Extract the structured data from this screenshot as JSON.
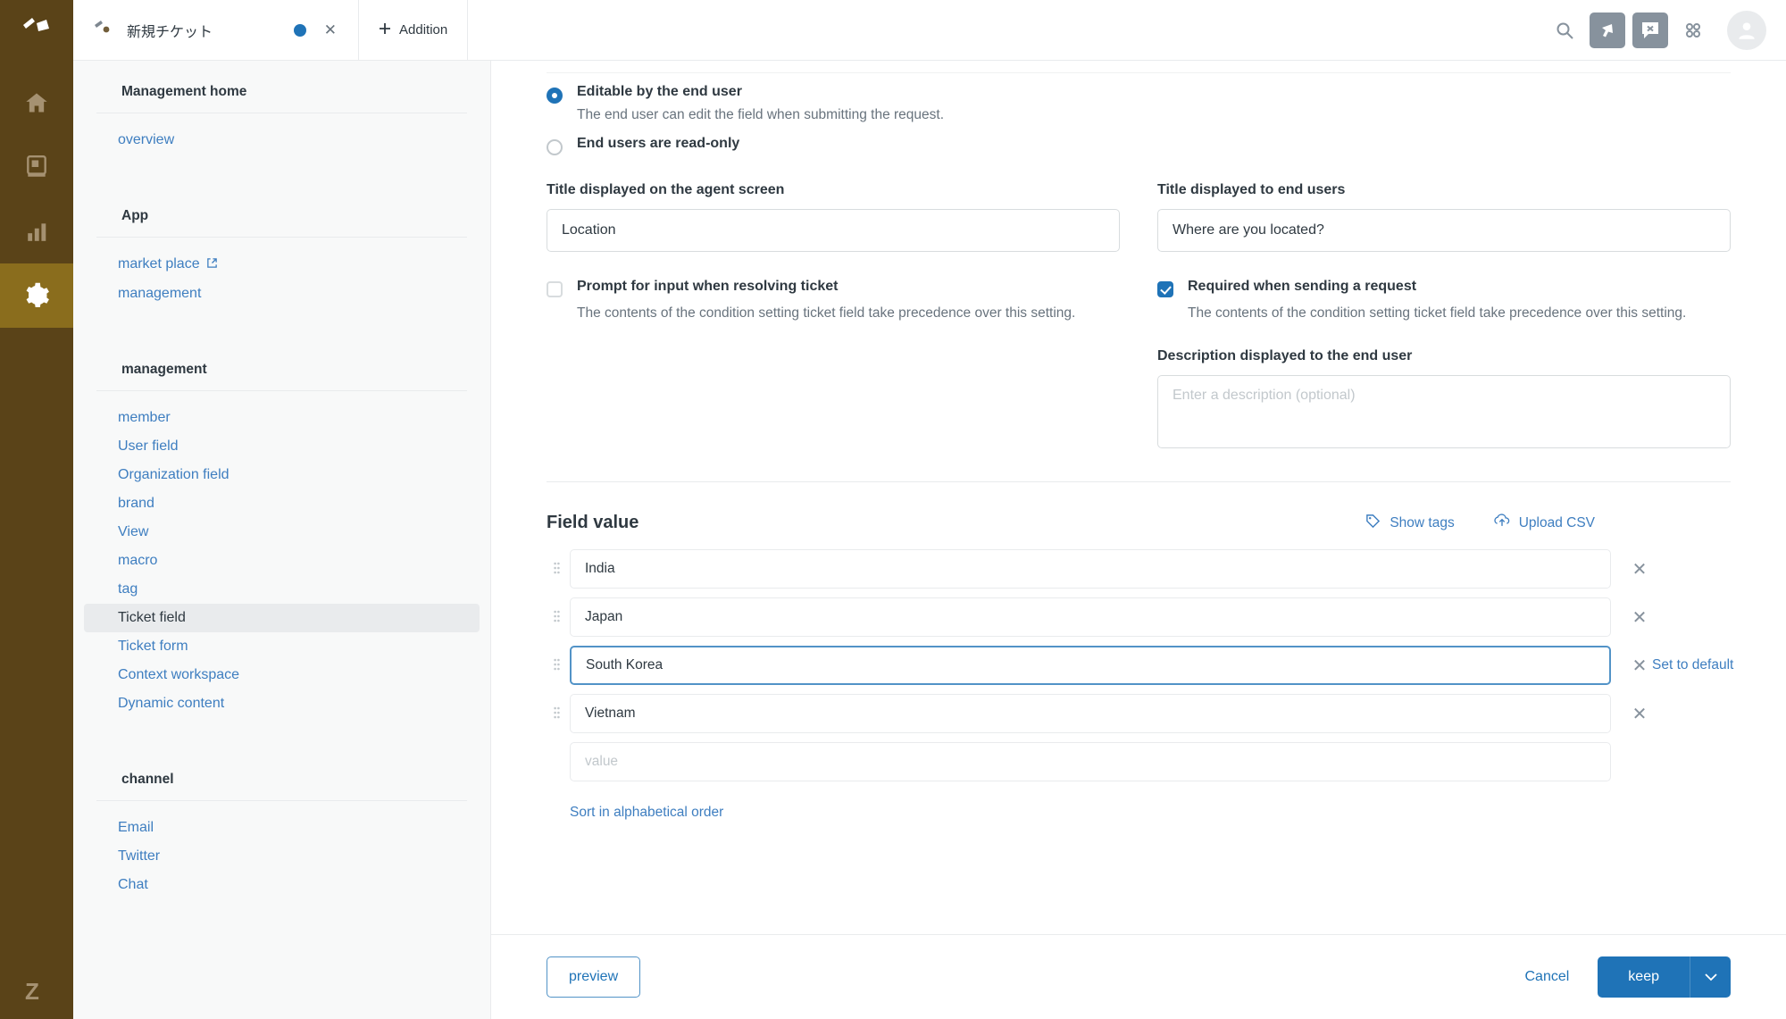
{
  "rail": {
    "logo_icon": "zendesk-logo-icon",
    "items": [
      {
        "name": "home",
        "icon": "home-icon",
        "active": false
      },
      {
        "name": "knowledge",
        "icon": "book-icon",
        "active": false
      },
      {
        "name": "reporting",
        "icon": "bar-chart-icon",
        "active": false
      },
      {
        "name": "admin",
        "icon": "gear-icon",
        "active": true
      }
    ],
    "bottom_icon": "zendesk-z-icon"
  },
  "topbar": {
    "tab": {
      "icon": "ticket-icon",
      "label": "新規チケット",
      "status_icon": "unsaved-dot-icon",
      "close_icon": "close-icon"
    },
    "add_tab": {
      "icon": "plus-icon",
      "label": "Addition"
    },
    "actions": [
      {
        "name": "search",
        "icon": "search-icon",
        "boxed": false
      },
      {
        "name": "unknown-arrow",
        "icon": "cursor-arrow-icon",
        "boxed": true
      },
      {
        "name": "chat-bubble",
        "icon": "chat-bubble-icon",
        "boxed": true
      },
      {
        "name": "apps-grid",
        "icon": "apps-grid-icon",
        "boxed": false
      }
    ],
    "avatar_icon": "user-avatar-icon"
  },
  "sidebar": {
    "sections": [
      {
        "heading": "Management home",
        "items": [
          {
            "label": "overview",
            "active": false,
            "external": false
          }
        ]
      },
      {
        "heading": "App",
        "items": [
          {
            "label": "market place",
            "active": false,
            "external": true
          },
          {
            "label": "management",
            "active": false,
            "external": false
          }
        ]
      },
      {
        "heading": "management",
        "items": [
          {
            "label": "member",
            "active": false,
            "external": false
          },
          {
            "label": "User field",
            "active": false,
            "external": false
          },
          {
            "label": "Organization field",
            "active": false,
            "external": false
          },
          {
            "label": "brand",
            "active": false,
            "external": false
          },
          {
            "label": "View",
            "active": false,
            "external": false
          },
          {
            "label": "macro",
            "active": false,
            "external": false
          },
          {
            "label": "tag",
            "active": false,
            "external": false
          },
          {
            "label": "Ticket field",
            "active": true,
            "external": false
          },
          {
            "label": "Ticket form",
            "active": false,
            "external": false
          },
          {
            "label": "Context workspace",
            "active": false,
            "external": false
          },
          {
            "label": "Dynamic content",
            "active": false,
            "external": false
          }
        ]
      },
      {
        "heading": "channel",
        "items": [
          {
            "label": "Email",
            "active": false,
            "external": false
          },
          {
            "label": "Twitter",
            "active": false,
            "external": false
          },
          {
            "label": "Chat",
            "active": false,
            "external": false
          }
        ]
      }
    ]
  },
  "permissions": {
    "option_editable": {
      "label": "Editable by the end user",
      "help": "The end user can edit the field when submitting the request.",
      "selected": true
    },
    "option_readonly": {
      "label": "End users are read-only",
      "selected": false
    }
  },
  "titles": {
    "agent": {
      "label": "Title displayed on the agent screen",
      "value": "Location",
      "placeholder": ""
    },
    "enduser": {
      "label": "Title displayed to end users",
      "value": "Where are you located?",
      "placeholder": ""
    }
  },
  "options": {
    "prompt_on_solve": {
      "label": "Prompt for input when resolving ticket",
      "help": "The contents of the condition setting ticket field take precedence over this setting.",
      "checked": false
    },
    "required_on_submit": {
      "label": "Required when sending a request",
      "help": "The contents of the condition setting ticket field take precedence over this setting.",
      "checked": true
    }
  },
  "description": {
    "label": "Description displayed to the end user",
    "value": "",
    "placeholder": "Enter a description (optional)"
  },
  "field_value": {
    "title": "Field value",
    "show_tags": {
      "label": "Show tags",
      "icon": "tag-icon"
    },
    "upload_csv": {
      "label": "Upload CSV",
      "icon": "upload-icon"
    },
    "rows": [
      {
        "value": "India",
        "placeholder": "",
        "focused": false,
        "set_default_label": ""
      },
      {
        "value": "Japan",
        "placeholder": "",
        "focused": false,
        "set_default_label": ""
      },
      {
        "value": "South Korea",
        "placeholder": "",
        "focused": true,
        "set_default_label": "Set to default"
      },
      {
        "value": "Vietnam",
        "placeholder": "",
        "focused": false,
        "set_default_label": ""
      },
      {
        "value": "",
        "placeholder": "value",
        "focused": false,
        "set_default_label": ""
      }
    ],
    "sort_link": "Sort in alphabetical order"
  },
  "footer": {
    "preview_label": "preview",
    "cancel_label": "Cancel",
    "keep_label": "keep",
    "keep_caret_icon": "chevron-down-icon"
  },
  "colors": {
    "brand_rail": "#5a4318",
    "rail_active": "#8a6d1d",
    "accent_blue": "#1f73b7",
    "link_blue": "#3e7ec0",
    "text_dark": "#2f3941",
    "text_muted": "#68737d",
    "border": "#e9ebed"
  }
}
